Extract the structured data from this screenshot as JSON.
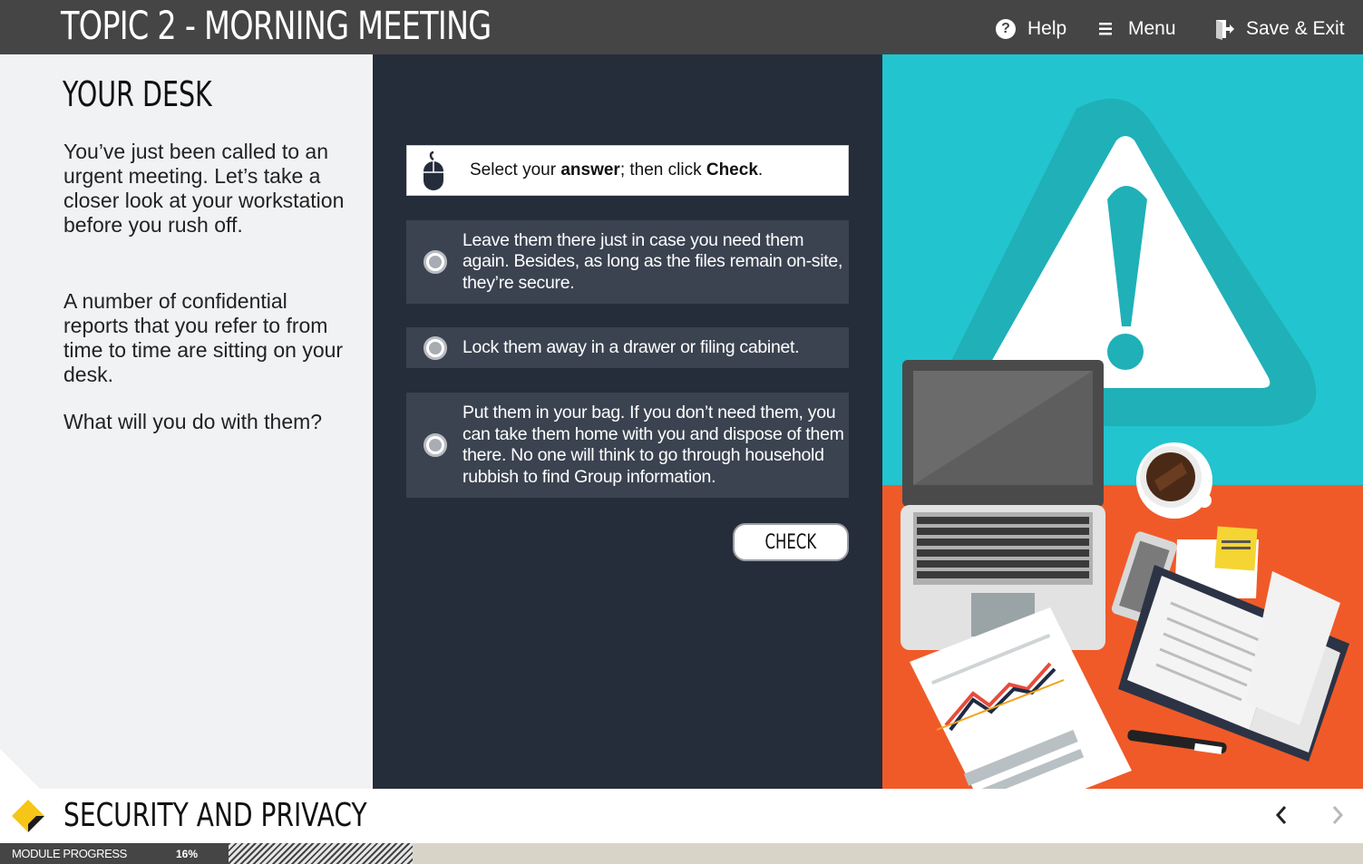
{
  "header": {
    "title": "TOPIC 2 - MORNING MEETING",
    "help_label": "Help",
    "menu_label": "Menu",
    "save_exit_label": "Save & Exit"
  },
  "left_panel": {
    "heading": "YOUR DESK",
    "paragraph_1": "You’ve just been called to an urgent meeting. Let’s take a closer look at your workstation before you rush off.",
    "paragraph_2": "A number of confidential reports that you refer to from time to time are sitting on your desk.",
    "question": "What will you do with them?"
  },
  "instruction": {
    "prefix": "Select your ",
    "answer_word": "answer",
    "middle": "; then click ",
    "check_word": "Check",
    "suffix": "."
  },
  "options": [
    {
      "label": "Leave them there just in case you need them again. Besides, as long as the files remain on-site, they’re secure.",
      "selected": false
    },
    {
      "label": "Lock them away in a drawer or filing cabinet.",
      "selected": false
    },
    {
      "label": "Put them in your bag. If you don’t need them, you can take them home with you and dispose of them there. No one will think to go through household rubbish to find Group information.",
      "selected": false
    }
  ],
  "check_button_label": "CHECK",
  "footer": {
    "module_title": "SECURITY AND PRIVACY",
    "prev_icon": "chevron-left-icon",
    "next_icon": "chevron-right-icon"
  },
  "progress": {
    "label": "MODULE PROGRESS",
    "percent_text": "16%",
    "value": 0.16
  },
  "colors": {
    "header_bg": "#454545",
    "left_bg": "#f1f2f4",
    "mid_bg": "#252d3b",
    "option_bg": "#3b4350",
    "illus_teal": "#22c4cf",
    "illus_orange": "#f05a28",
    "logo_yellow": "#f5c518"
  },
  "illustration": {
    "icons": [
      "warning-triangle-icon",
      "laptop-icon",
      "coffee-cup-icon",
      "sticky-note-icon",
      "smartphone-icon",
      "notebook-icon",
      "pen-icon",
      "report-chart-icon"
    ]
  }
}
